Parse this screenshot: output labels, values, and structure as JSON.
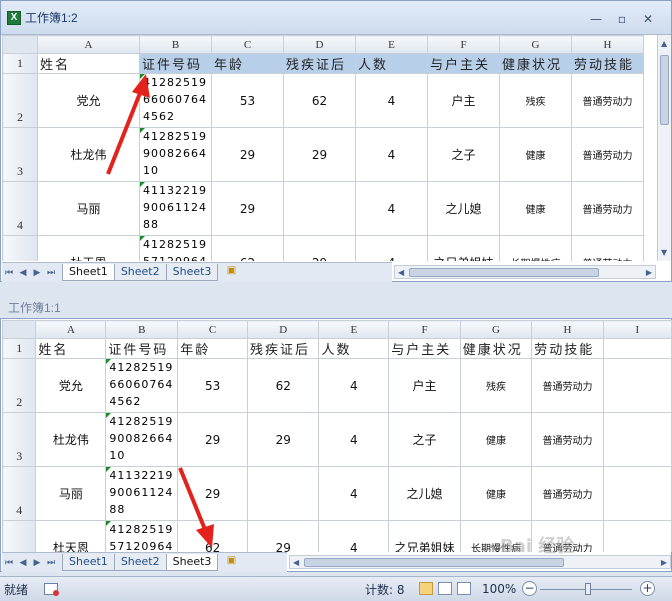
{
  "windows": {
    "top": {
      "title": "工作簿1:2"
    },
    "bottom": {
      "title": "工作簿1:1"
    },
    "controls": {
      "minimize": "—",
      "restore": "▫",
      "close": "✕"
    }
  },
  "columns": [
    "A",
    "B",
    "C",
    "D",
    "E",
    "F",
    "G",
    "H",
    "I"
  ],
  "header_row": {
    "num": "1",
    "cells": [
      "姓名",
      "证件号码",
      "年龄",
      "残疾证后",
      "人数",
      "与户主关",
      "健康状况",
      "劳动技能"
    ]
  },
  "rows": [
    {
      "num": "2",
      "name": "党允",
      "id": "412825196606076 44562",
      "age": "53",
      "disability": "62",
      "count": "4",
      "relation": "户主",
      "health": "残疾",
      "skill": "普通劳动力"
    },
    {
      "num": "3",
      "name": "杜龙伟",
      "id": "412825199008266 410",
      "age": "29",
      "disability": "29",
      "count": "4",
      "relation": "之子",
      "health": "健康",
      "skill": "普通劳动力"
    },
    {
      "num": "4",
      "name": "马丽",
      "id": "411322199006112 488",
      "age": "29",
      "disability": "",
      "count": "4",
      "relation": "之儿媳",
      "health": "健康",
      "skill": "普通劳动力"
    },
    {
      "num": "5",
      "name": "杜天恩",
      "id": "412825195712096",
      "age": "62",
      "disability": "29",
      "count": "4",
      "relation": "之兄弟姐妹",
      "health": "长期慢性病",
      "skill": "普通劳动力"
    }
  ],
  "id_lines": [
    [
      "41282519",
      "66060764",
      "4562"
    ],
    [
      "41282519",
      "90082664",
      "10"
    ],
    [
      "41132219",
      "90061124",
      "88"
    ],
    [
      "41282519",
      "57120964"
    ]
  ],
  "sheets": {
    "top": [
      "Sheet1",
      "Sheet2",
      "Sheet3"
    ],
    "top_active": "Sheet1",
    "bottom": [
      "Sheet1",
      "Sheet2",
      "Sheet3"
    ],
    "bottom_active": "Sheet3",
    "nav": [
      "⏮",
      "◀",
      "▶",
      "⏭"
    ]
  },
  "status": {
    "ready": "就绪",
    "count": "计数: 8",
    "zoom": "100%",
    "zoom_minus": "−",
    "zoom_plus": "+"
  },
  "watermark": "Bai 经验"
}
